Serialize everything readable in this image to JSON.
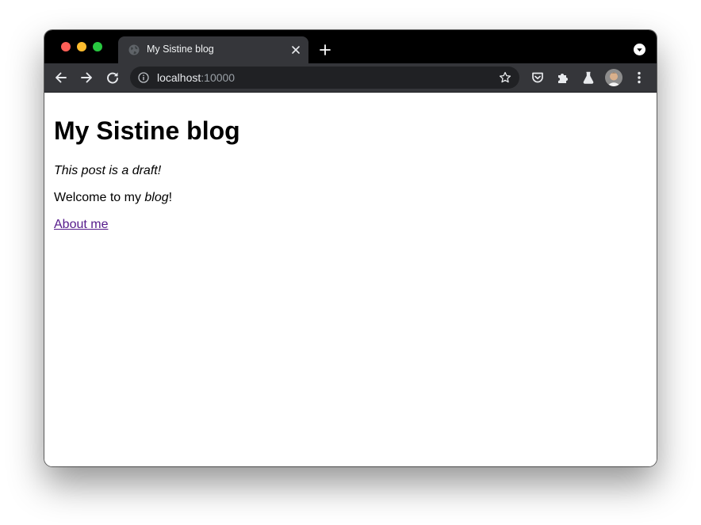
{
  "tab": {
    "title": "My Sistine blog"
  },
  "omnibox": {
    "host": "localhost",
    "port": ":10000"
  },
  "page": {
    "heading": "My Sistine blog",
    "draft_note": "This post is a draft!",
    "welcome_before": "Welcome to my ",
    "welcome_emphasis": "blog",
    "welcome_after": "!",
    "about_link": "About me"
  },
  "icons": {
    "back": "back-arrow-icon",
    "forward": "forward-arrow-icon",
    "reload": "reload-icon",
    "info": "info-icon",
    "star": "star-icon",
    "pocket": "pocket-icon",
    "extensions": "puzzle-icon",
    "labs": "labs-flask-icon",
    "menu": "kebab-menu-icon"
  },
  "colors": {
    "tab_strip": "#000000",
    "toolbar": "#35363a",
    "omnibox": "#202124",
    "visited_link": "#551a8b"
  }
}
